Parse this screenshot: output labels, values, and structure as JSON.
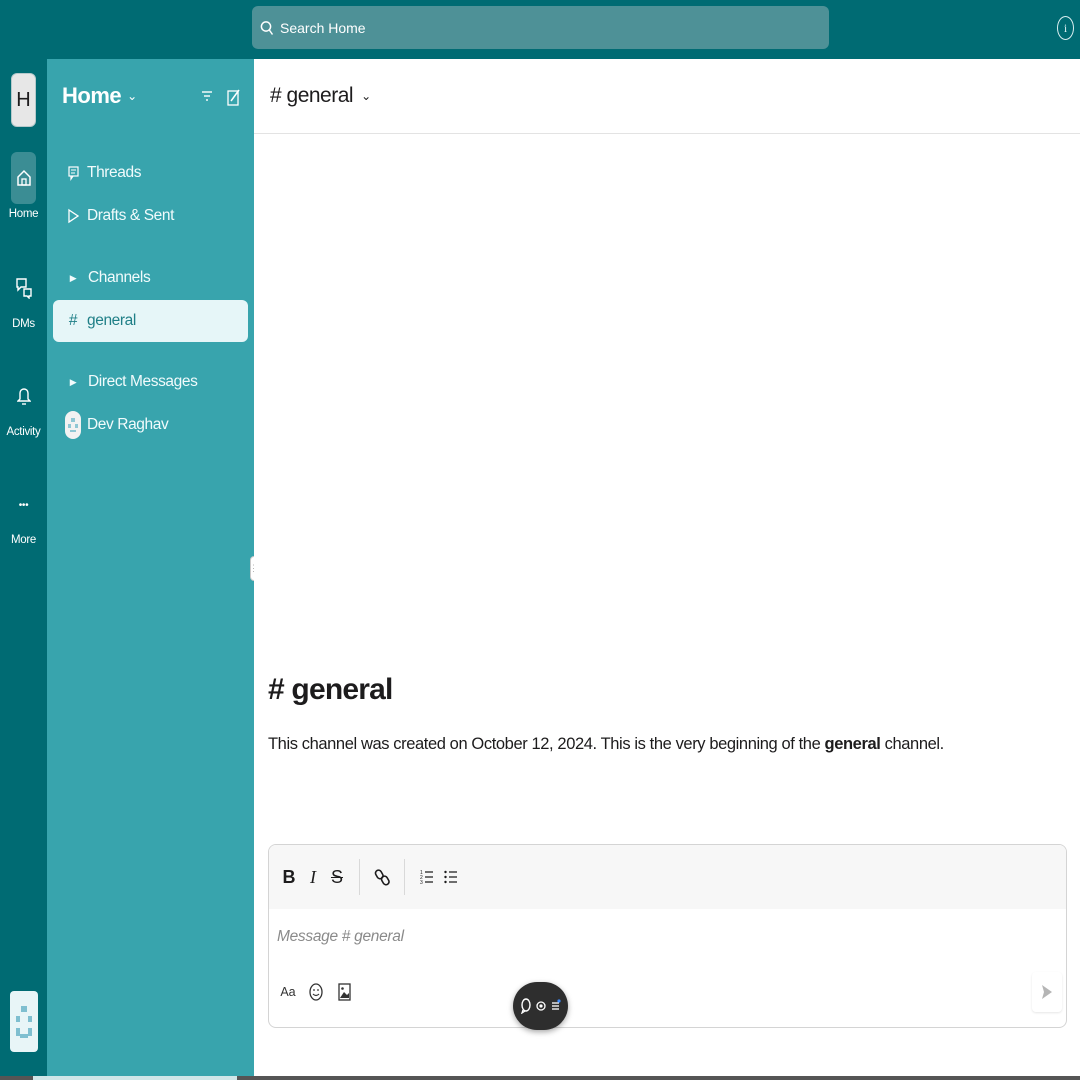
{
  "search": {
    "placeholder": "Search Home",
    "icon": "search-icon"
  },
  "help": {
    "icon": "info-icon",
    "glyph": "i"
  },
  "workspace": {
    "initial": "H",
    "name": "Home",
    "chevron": "⌄"
  },
  "rail": {
    "items": [
      {
        "label": "Home",
        "icon": "home-icon",
        "active": true
      },
      {
        "label": "DMs",
        "icon": "dms-icon",
        "active": false
      },
      {
        "label": "Activity",
        "icon": "bell-icon",
        "active": false
      },
      {
        "label": "More",
        "icon": "more-icon",
        "glyph": "•••",
        "active": false
      }
    ]
  },
  "sidebar": {
    "threads": "Threads",
    "drafts": "Drafts & Sent",
    "channels_header": "Channels",
    "channels": [
      {
        "name": "general",
        "prefix": "#",
        "active": true
      }
    ],
    "dm_header": "Direct Messages",
    "dms": [
      {
        "name": "Dev Raghav"
      }
    ]
  },
  "channel": {
    "header_name": "# general",
    "chevron": "⌄",
    "intro_title": "# general",
    "intro_text_before": "This channel was created on October 12, 2024. This is the very beginning of the ",
    "intro_text_bold": "general",
    "intro_text_after": " channel."
  },
  "composer": {
    "bold": "B",
    "italic": "I",
    "strike": "S",
    "placeholder": "Message # general",
    "format_label": "Aa"
  },
  "colors": {
    "topbar": "#006b73",
    "sidebar": "#38a4ad",
    "active_item_bg": "#e6f6f8",
    "search_bg": "#4e9197"
  }
}
